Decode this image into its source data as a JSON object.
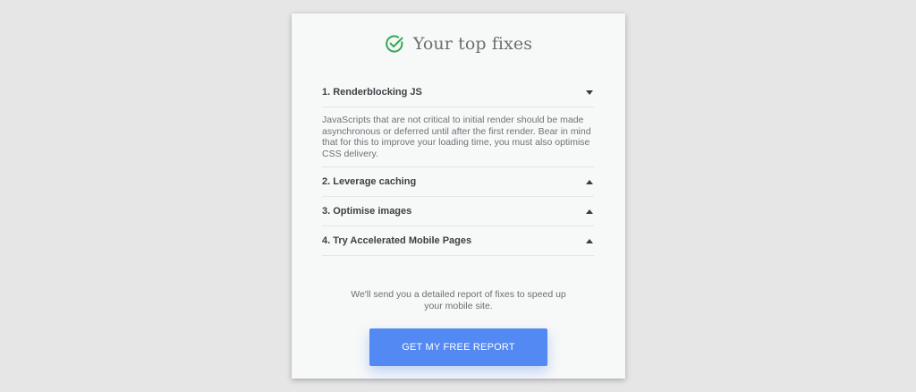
{
  "header": {
    "icon": "check-circle-icon",
    "icon_color": "#34a853",
    "title": "Your top fixes"
  },
  "fixes": [
    {
      "title": "1. Renderblocking JS",
      "expanded": true,
      "caret_icon": "caret-down-icon",
      "description": "JavaScripts that are not critical to initial render should be made asynchronous or deferred until after the first render. Bear in mind that for this to improve your loading time, you must also optimise CSS delivery."
    },
    {
      "title": "2. Leverage caching",
      "expanded": false,
      "caret_icon": "caret-up-icon"
    },
    {
      "title": "3. Optimise images",
      "expanded": false,
      "caret_icon": "caret-up-icon"
    },
    {
      "title": "4. Try Accelerated Mobile Pages",
      "expanded": false,
      "caret_icon": "caret-up-icon"
    }
  ],
  "footer": {
    "text": "We'll send you a detailed report of fixes to speed up your mobile site.",
    "button_label": "GET MY FREE REPORT",
    "button_color": "#5289f2"
  }
}
